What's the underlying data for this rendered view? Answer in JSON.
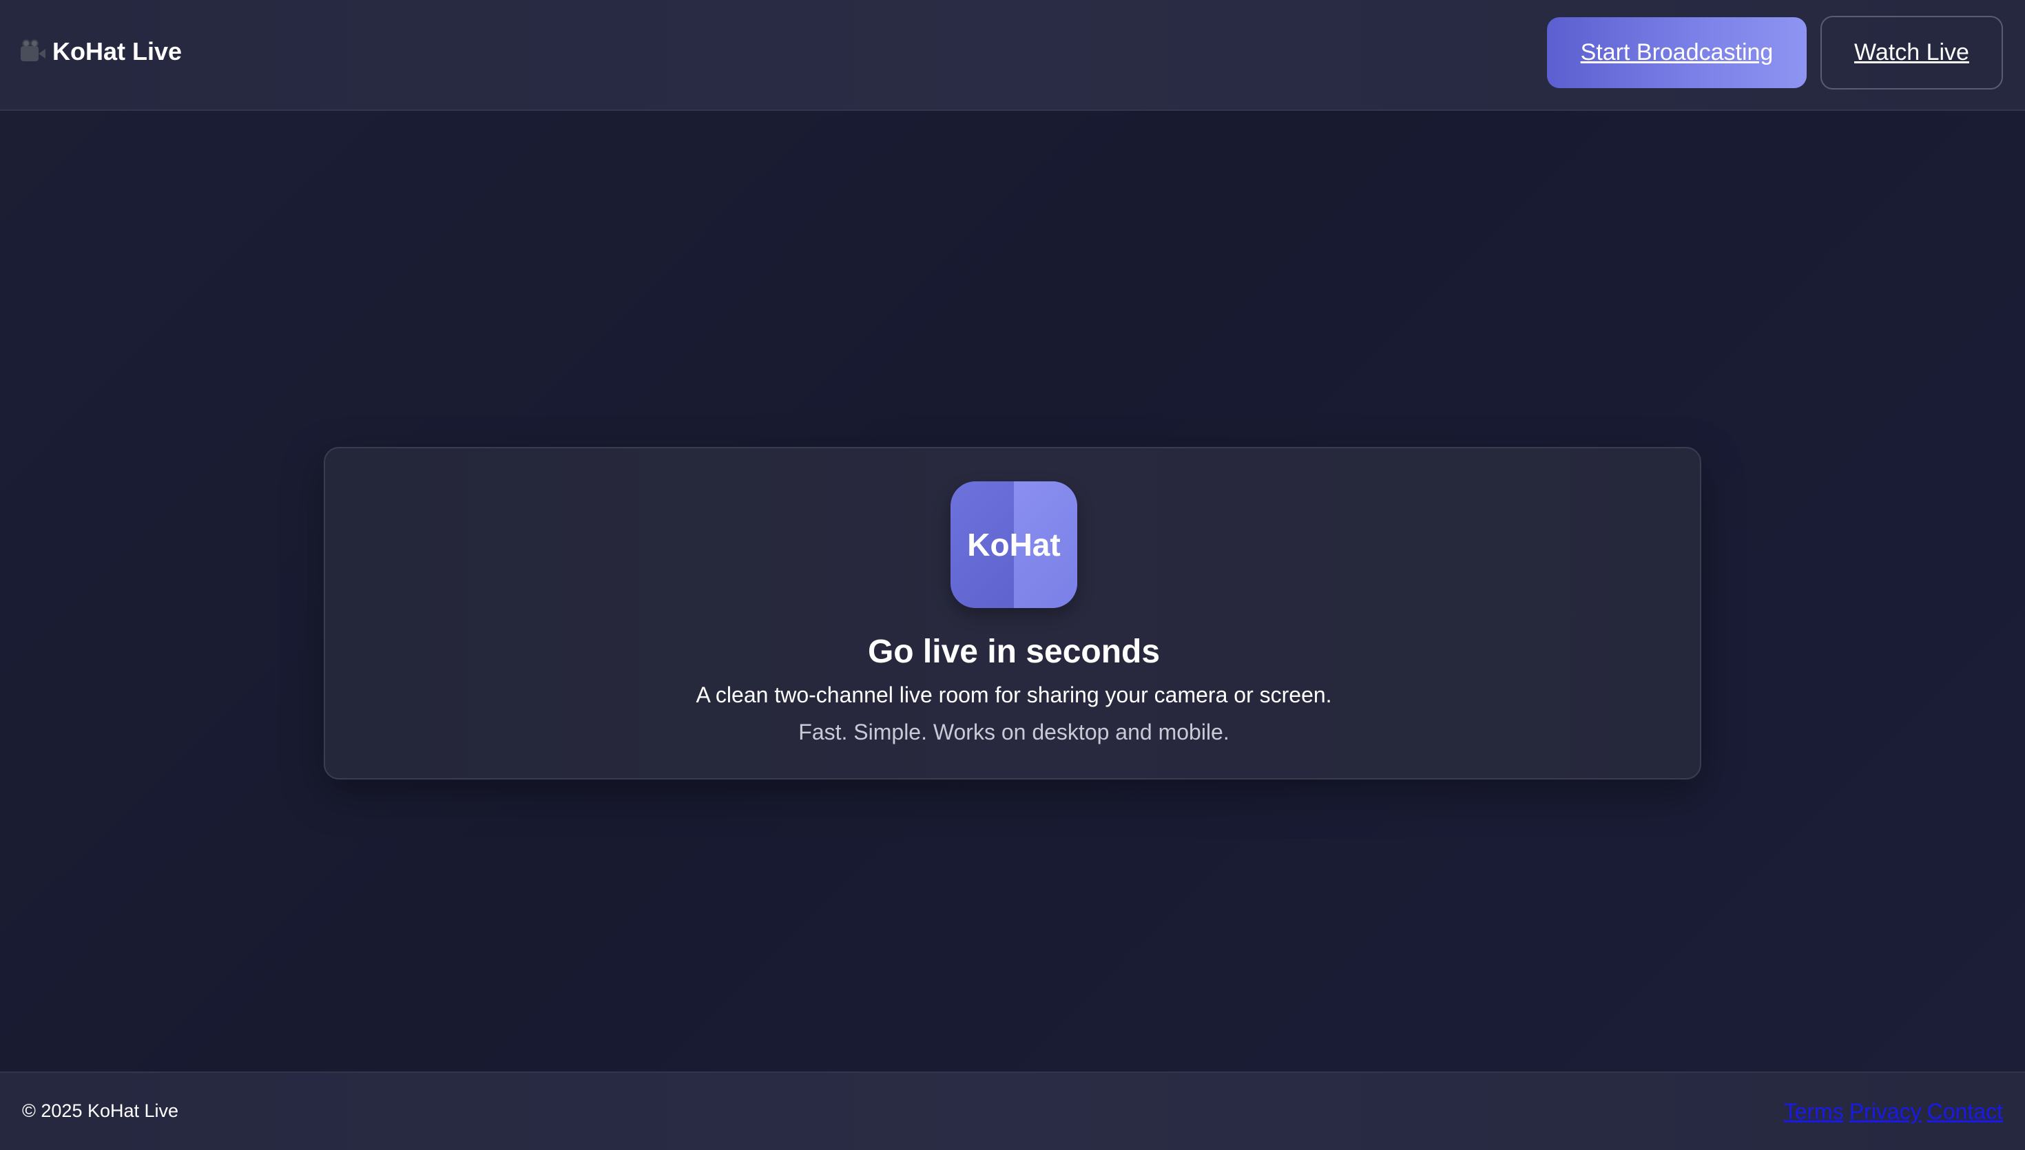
{
  "header": {
    "brand_name": "KoHat Live",
    "brand_icon": "movie-camera-icon",
    "start_broadcasting_label": "Start Broadcasting",
    "watch_live_label": "Watch Live"
  },
  "card": {
    "logo_text": "KoHat",
    "title": "Go live in seconds",
    "line1": "A clean two-channel live room for sharing your camera or screen.",
    "line2": "Fast. Simple. Works on desktop and mobile."
  },
  "footer": {
    "copyright": "© 2025 KoHat Live",
    "links": [
      {
        "label": "Terms"
      },
      {
        "label": "Privacy"
      },
      {
        "label": "Contact"
      }
    ]
  },
  "colors": {
    "accent_start": "#5b5fd0",
    "accent_end": "#8e94f0",
    "background": "#181a30",
    "link": "#1a1ae6"
  }
}
